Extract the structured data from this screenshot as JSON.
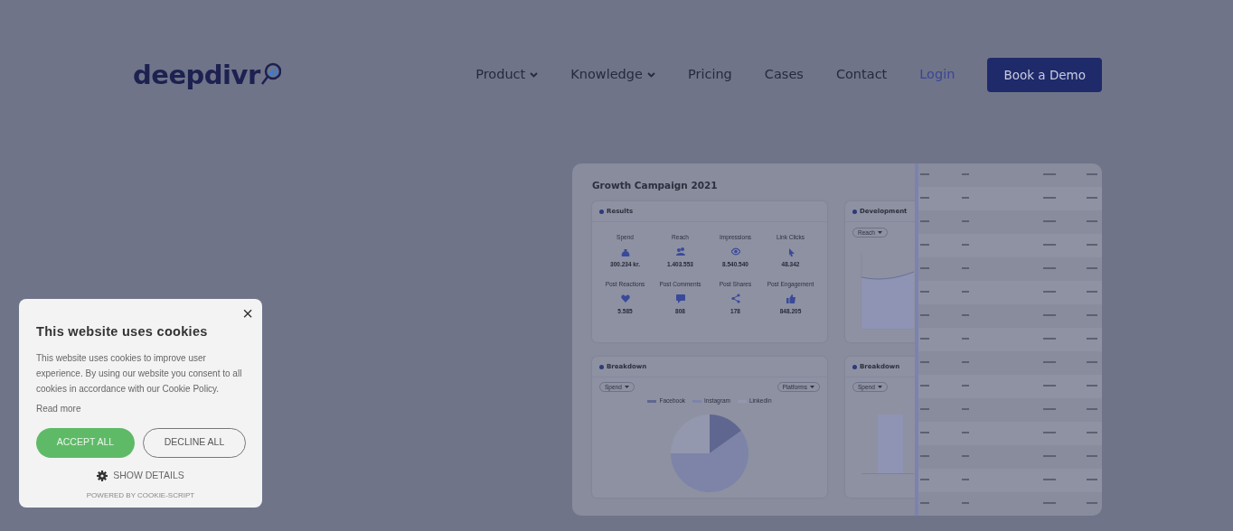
{
  "nav": {
    "logo": "deepdivr",
    "items": [
      {
        "label": "Product",
        "dropdown": true,
        "kind": "menu"
      },
      {
        "label": "Knowledge",
        "dropdown": true,
        "kind": "menu"
      },
      {
        "label": "Pricing",
        "dropdown": false,
        "kind": "menu"
      },
      {
        "label": "Cases",
        "dropdown": false,
        "kind": "menu"
      },
      {
        "label": "Contact",
        "dropdown": false,
        "kind": "menu"
      },
      {
        "label": "Login",
        "dropdown": false,
        "kind": "login"
      }
    ],
    "cta": "Book a Demo"
  },
  "dashboard": {
    "title": "Growth Campaign 2021",
    "results": {
      "heading": "Results",
      "metrics": [
        {
          "label": "Spend",
          "value": "300.234 kr."
        },
        {
          "label": "Reach",
          "value": "1.403.553"
        },
        {
          "label": "Impressions",
          "value": "8.540.540"
        },
        {
          "label": "Link Clicks",
          "value": "48.342"
        },
        {
          "label": "Post Reactions",
          "value": "5.585"
        },
        {
          "label": "Post Comments",
          "value": "808"
        },
        {
          "label": "Post Shares",
          "value": "178"
        },
        {
          "label": "Post Engagement",
          "value": "848.205"
        }
      ]
    },
    "development": {
      "heading": "Development",
      "filter": "Reach"
    },
    "breakdown": {
      "heading": "Breakdown",
      "filter": "Spend",
      "group": "Platforms",
      "legend": [
        {
          "label": "Facebook",
          "color": "#5f6790"
        },
        {
          "label": "Instagram",
          "color": "#7d84a8"
        },
        {
          "label": "LinkedIn",
          "color": "#9498ae"
        }
      ]
    },
    "breakdown_2": {
      "heading": "Breakdown",
      "filter": "Spend"
    }
  },
  "cookie": {
    "title": "This website uses cookies",
    "text": "This website uses cookies to improve user experience. By using our website you consent to all cookies in accordance with our Cookie Policy.",
    "read_more": "Read more",
    "accept": "ACCEPT ALL",
    "decline": "DECLINE ALL",
    "details": "SHOW DETAILS",
    "powered": "POWERED BY COOKIE-SCRIPT",
    "close": "×"
  }
}
